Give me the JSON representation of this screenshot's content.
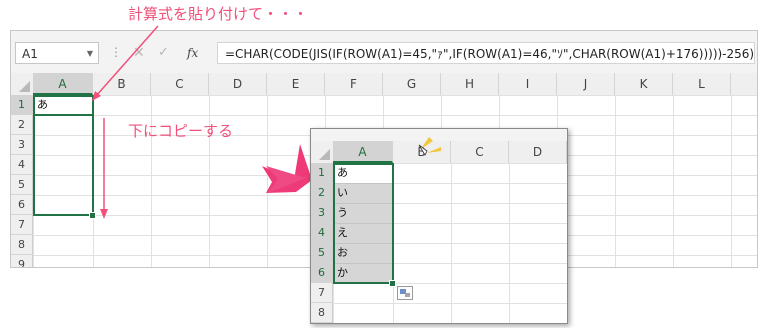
{
  "annotations": {
    "paste_formula": "計算式を貼り付けて・・・",
    "copy_down": "下にコピーする"
  },
  "colors": {
    "annotation": "#f0507a",
    "selection": "#217346"
  },
  "main_sheet": {
    "name_box": "A1",
    "fx_icon": "fx",
    "formula": "=CHAR(CODE(JIS(IF(ROW(A1)=45,\"ｧ\",IF(ROW(A1)=46,\"ｿ\",CHAR(ROW(A1)+176)))))-256)",
    "columns": [
      "A",
      "B",
      "C",
      "D",
      "E",
      "F",
      "G",
      "H",
      "I",
      "J",
      "K",
      "L"
    ],
    "rows": [
      "1",
      "2",
      "3",
      "4",
      "5",
      "6",
      "7",
      "8",
      "9"
    ],
    "cells": {
      "A1": "あ"
    }
  },
  "inset_sheet": {
    "columns": [
      "A",
      "B",
      "C",
      "D"
    ],
    "rows": [
      "1",
      "2",
      "3",
      "4",
      "5",
      "6",
      "7",
      "8"
    ],
    "values": [
      "あ",
      "い",
      "う",
      "え",
      "お",
      "か"
    ]
  }
}
